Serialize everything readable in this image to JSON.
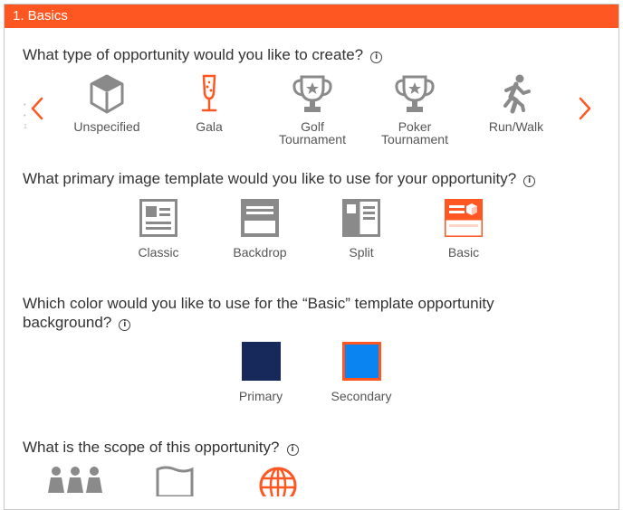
{
  "section": {
    "title": "1. Basics",
    "accent": "#ff5722"
  },
  "opportunity_type": {
    "question": "What type of opportunity would you like to create?",
    "info_icon": "info-icon",
    "items": [
      {
        "label": "Unspecified",
        "icon": "cube-icon",
        "selected": false
      },
      {
        "label": "Gala",
        "icon": "champagne-glass-icon",
        "selected": true
      },
      {
        "label": "Golf Tournament",
        "label_line1": "Golf",
        "label_line2": "Tournament",
        "icon": "trophy-icon",
        "selected": false
      },
      {
        "label": "Poker Tournament",
        "label_line1": "Poker",
        "label_line2": "Tournament",
        "icon": "trophy-icon",
        "selected": false
      },
      {
        "label": "Run/Walk",
        "icon": "runner-icon",
        "selected": false
      }
    ]
  },
  "image_template": {
    "question": "What primary image template would you like to use for your opportunity?",
    "items": [
      {
        "label": "Classic",
        "selected": false
      },
      {
        "label": "Backdrop",
        "selected": false
      },
      {
        "label": "Split",
        "selected": false
      },
      {
        "label": "Basic",
        "selected": true
      }
    ]
  },
  "background_color": {
    "question_line1": "Which color would you like to use for the “Basic” template opportunity",
    "question_line2": "background?",
    "items": [
      {
        "label": "Primary",
        "color": "#17285a",
        "selected": false
      },
      {
        "label": "Secondary",
        "color": "#0a84f0",
        "selected": true
      }
    ]
  },
  "scope": {
    "question": "What is the scope of this opportunity?",
    "items": [
      {
        "icon": "group-icon"
      },
      {
        "icon": "flag-icon"
      },
      {
        "icon": "globe-icon"
      }
    ]
  }
}
